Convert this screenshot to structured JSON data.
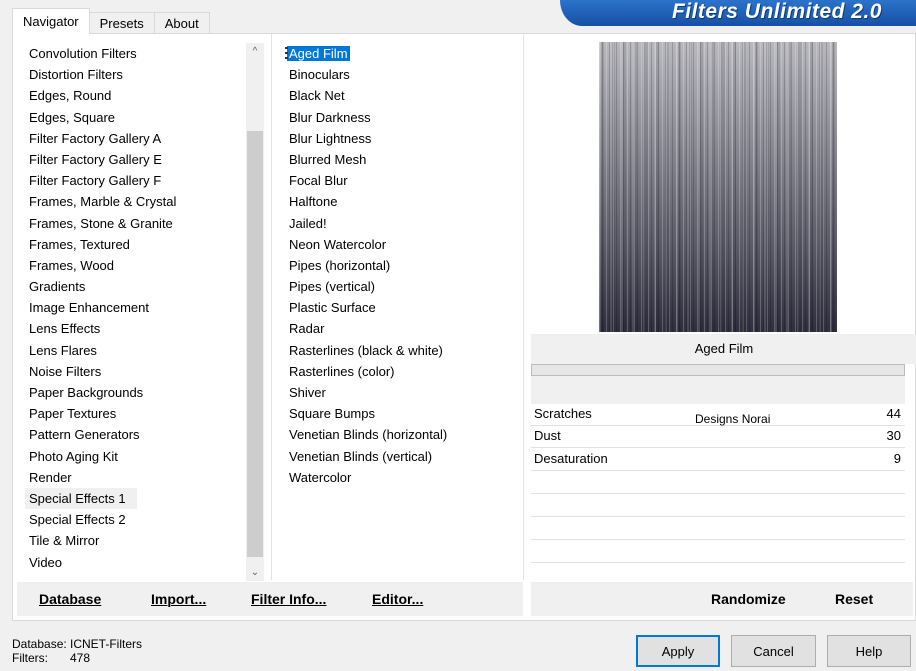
{
  "tabs": [
    "Navigator",
    "Presets",
    "About"
  ],
  "banner_title": "Filters Unlimited 2.0",
  "categories": [
    "Convolution Filters",
    "Distortion Filters",
    "Edges, Round",
    "Edges, Square",
    "Filter Factory Gallery A",
    "Filter Factory Gallery E",
    "Filter Factory Gallery F",
    "Frames, Marble & Crystal",
    "Frames, Stone & Granite",
    "Frames, Textured",
    "Frames, Wood",
    "Gradients",
    "Image Enhancement",
    "Lens Effects",
    "Lens Flares",
    "Noise Filters",
    "Paper Backgrounds",
    "Paper Textures",
    "Pattern Generators",
    "Photo Aging Kit",
    "Render",
    "Special Effects 1",
    "Special Effects 2",
    "Tile & Mirror",
    "Video"
  ],
  "selected_category": "Special Effects 1",
  "filters": [
    "Aged Film",
    "Binoculars",
    "Black Net",
    "Blur Darkness",
    "Blur Lightness",
    "Blurred Mesh",
    "Focal Blur",
    "Halftone",
    "Jailed!",
    "Neon Watercolor",
    "Pipes (horizontal)",
    "Pipes (vertical)",
    "Plastic Surface",
    "Radar",
    "Rasterlines (black & white)",
    "Rasterlines (color)",
    "Shiver",
    "Square Bumps",
    "Venetian Blinds (horizontal)",
    "Venetian Blinds (vertical)",
    "Watercolor"
  ],
  "selected_filter": "Aged Film",
  "preview_title": "Aged Film",
  "credit": "Designs Norai",
  "params": [
    {
      "name": "Scratches",
      "value": "44"
    },
    {
      "name": "Dust",
      "value": "30"
    },
    {
      "name": "Desaturation",
      "value": "9"
    }
  ],
  "left_buttons": {
    "database": "Database",
    "import": "Import...",
    "filter_info": "Filter Info...",
    "editor": "Editor..."
  },
  "right_buttons": {
    "randomize": "Randomize",
    "reset": "Reset"
  },
  "status": {
    "database_label": "Database:",
    "database_value": "ICNET-Filters",
    "filters_label": "Filters:",
    "filters_value": "478"
  },
  "dialog": {
    "apply": "Apply",
    "cancel": "Cancel",
    "help": "Help"
  },
  "colors": {
    "accent": "#0078d7",
    "banner": "#1a5fb4"
  }
}
